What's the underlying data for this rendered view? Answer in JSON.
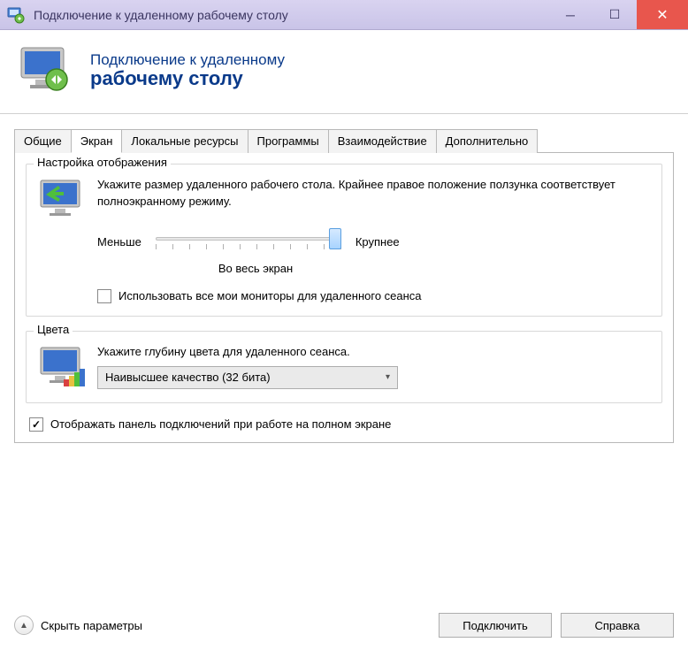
{
  "window": {
    "title": "Подключение к удаленному рабочему столу"
  },
  "header": {
    "line1": "Подключение к удаленному",
    "line2": "рабочему столу"
  },
  "tabs": [
    "Общие",
    "Экран",
    "Локальные ресурсы",
    "Программы",
    "Взаимодействие",
    "Дополнительно"
  ],
  "active_tab_index": 1,
  "display_group": {
    "title": "Настройка отображения",
    "description": "Укажите размер удаленного рабочего стола. Крайнее правое положение ползунка соответствует полноэкранному режиму.",
    "slider_min_label": "Меньше",
    "slider_max_label": "Крупнее",
    "slider_caption": "Во весь экран",
    "use_all_monitors": "Использовать все мои мониторы для удаленного сеанса"
  },
  "colors_group": {
    "title": "Цвета",
    "description": "Укажите глубину цвета для удаленного сеанса.",
    "selected": "Наивысшее качество (32 бита)"
  },
  "show_connection_bar": "Отображать панель подключений при работе на полном экране",
  "footer": {
    "hide_options": "Скрыть параметры",
    "connect": "Подключить",
    "help": "Справка"
  }
}
